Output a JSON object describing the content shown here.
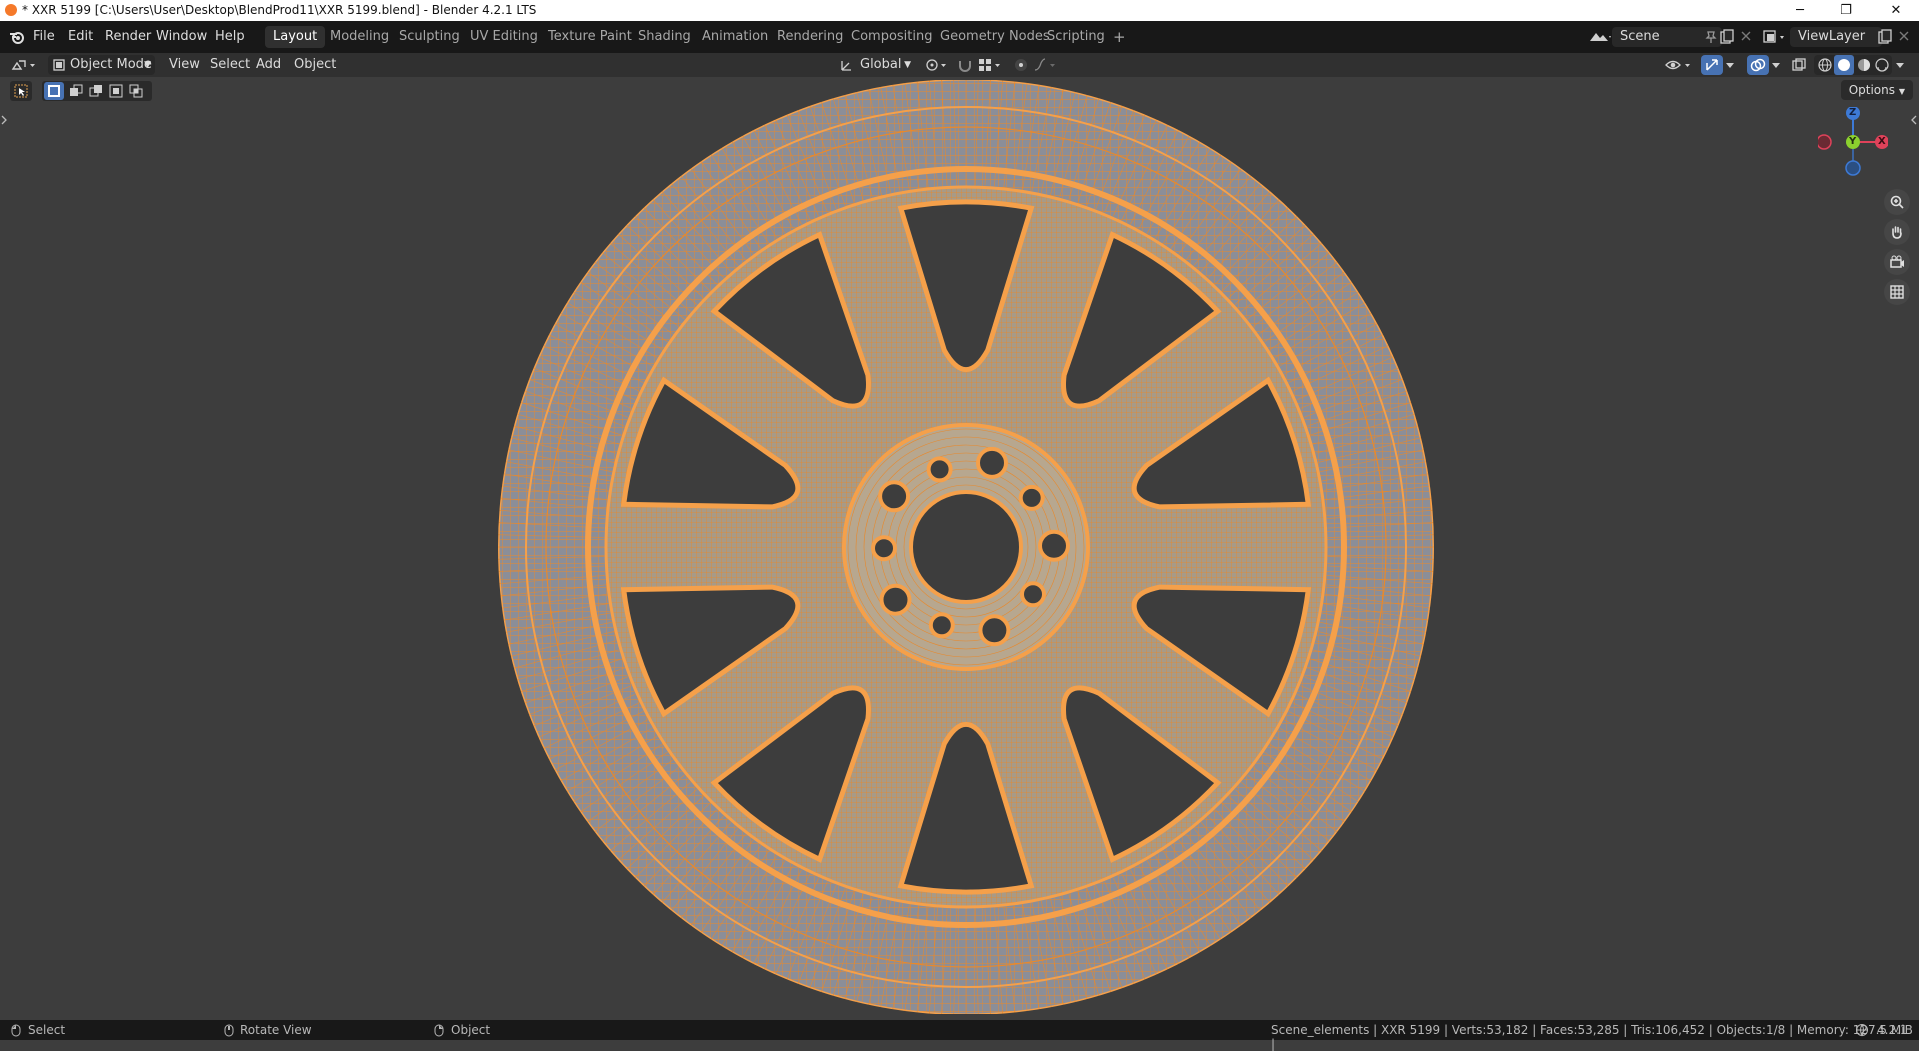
{
  "window": {
    "title": "* XXR 5199 [C:\\Users\\User\\Desktop\\BlendProd11\\XXR 5199.blend] - Blender 4.2.1 LTS",
    "minimize": "─",
    "maximize": "❐",
    "close": "✕"
  },
  "menus": [
    "File",
    "Edit",
    "Render",
    "Window",
    "Help"
  ],
  "workspaces": [
    "Layout",
    "Modeling",
    "Sculpting",
    "UV Editing",
    "Texture Paint",
    "Shading",
    "Animation",
    "Rendering",
    "Compositing",
    "Geometry Nodes",
    "Scripting"
  ],
  "active_workspace": "Layout",
  "add_workspace": "+",
  "scene": {
    "name": "Scene"
  },
  "view_layer": {
    "name": "ViewLayer"
  },
  "viewport_header": {
    "mode": "Object Mode",
    "menus": [
      "View",
      "Select",
      "Add",
      "Object"
    ],
    "transform_orientation": "Global"
  },
  "options_label": "Options",
  "gizmo": {
    "z": "Z",
    "y": "Y",
    "x": "X"
  },
  "statusbar": {
    "select": "Select",
    "rotate_view": "Rotate View",
    "object": "Object",
    "stats": "Scene_elements | XXR 5199 | Verts:53,182 | Faces:53,285 | Tris:106,452 | Objects:1/8 | Memory: 127.5 MiB |",
    "version": "4.2.1"
  },
  "colors": {
    "accent_orange": "#f5a04a",
    "wire_orange": "#e8892c",
    "viewport_bg": "#3d3d3d",
    "active_tab": "#303030",
    "gizmo_x": "#e0425a",
    "gizmo_y": "#8bd12e",
    "gizmo_z": "#3d7ad6"
  }
}
